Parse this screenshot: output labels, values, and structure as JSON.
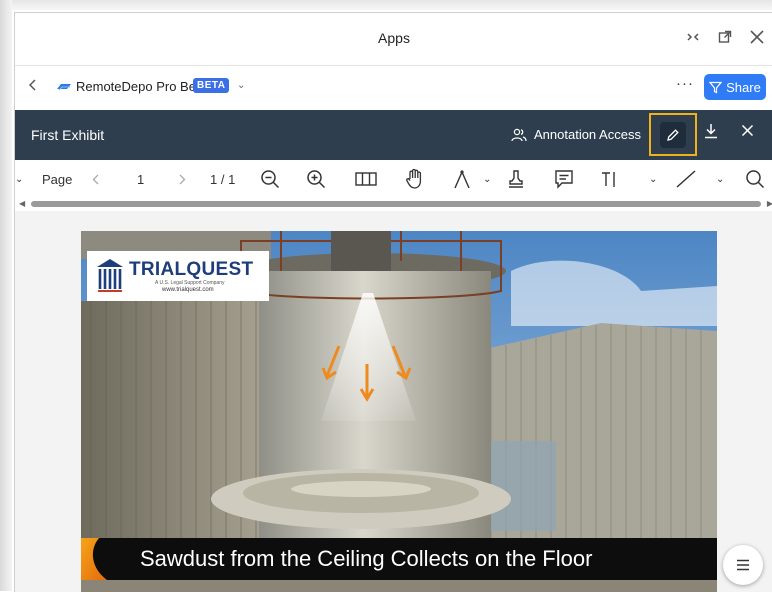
{
  "window": {
    "title": "Apps"
  },
  "appbar": {
    "app_name": "RemoteDepo Pro Beta",
    "badge": "BETA",
    "share_label": "Share"
  },
  "viewer": {
    "document_title": "First Exhibit",
    "annotation_access_label": "Annotation Access"
  },
  "toolbar": {
    "page_label": "Page",
    "page_value": "1",
    "page_count": "1 / 1"
  },
  "slide": {
    "logo_brand": "TRIALQUEST",
    "logo_tagline": "A U.S. Legal Support Company",
    "logo_url": "www.trialquest.com",
    "caption": "Sawdust from the Ceiling Collects on the Floor"
  },
  "colors": {
    "header_bg": "#2f3e4f",
    "accent": "#2f7cf6",
    "highlight_border": "#f0b21a",
    "beta_badge": "#3b6fe6"
  },
  "icons": [
    "restore-icon",
    "popout-icon",
    "close-icon",
    "back-icon",
    "more-icon",
    "filter-icon",
    "people-icon",
    "pencil-icon",
    "download-icon",
    "zoom-out-icon",
    "zoom-in-icon",
    "columns-icon",
    "hand-icon",
    "pen-tool-icon",
    "stamp-icon",
    "comment-icon",
    "text-cursor-icon",
    "line-icon",
    "search-icon",
    "menu-icon"
  ]
}
